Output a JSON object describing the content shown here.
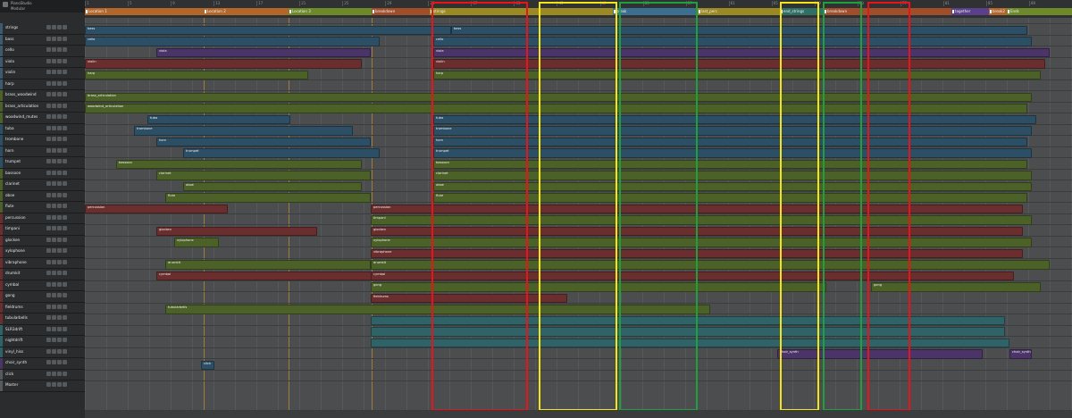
{
  "window": {
    "title": "PianoStudio",
    "project": "Modular"
  },
  "colors": {
    "blue": "#2c4f66",
    "green": "#4c6127",
    "red": "#6a2e2e",
    "purple": "#4b3468",
    "teal": "#2f6368",
    "highlight_red": "#e8141a",
    "highlight_yellow": "#f5e31a",
    "highlight_green": "#1fa03c"
  },
  "ruler": {
    "bars": [
      "1",
      "5",
      "9",
      "13",
      "17",
      "21",
      "25",
      "29",
      "33",
      "37",
      "41",
      "45",
      "49",
      "53",
      "57",
      "61",
      "65",
      "69",
      "73",
      "77",
      "81",
      "85",
      "89"
    ],
    "locators": [
      {
        "label": "Location 1",
        "color": "#b3662a"
      },
      {
        "label": "Location 2",
        "color": "#b3662a"
      },
      {
        "label": "Location 3",
        "color": "#6d8a2a"
      },
      {
        "label": "breakdown",
        "color": "#a04d2a"
      },
      {
        "label": "strings",
        "color": "#9b8a24"
      },
      {
        "label": "break",
        "color": "#3b6e8f"
      },
      {
        "label": "last_perc",
        "color": "#9b8a24"
      },
      {
        "label": "end_strings",
        "color": "#2f6f64"
      },
      {
        "label": "breakdown",
        "color": "#a04d2a"
      },
      {
        "label": "together",
        "color": "#5a3f8a"
      },
      {
        "label": "break2",
        "color": "#b3662a"
      },
      {
        "label": "Ends",
        "color": "#6d8a2a"
      }
    ]
  },
  "tracks": [
    {
      "name": "strings",
      "color": "#3d5a6e"
    },
    {
      "name": "bass",
      "color": "#3d5a6e"
    },
    {
      "name": "cello",
      "color": "#3d5a6e"
    },
    {
      "name": "viola",
      "color": "#3d5a6e"
    },
    {
      "name": "violin",
      "color": "#3d5a6e"
    },
    {
      "name": "harp",
      "color": "#3d5a6e"
    },
    {
      "name": "brass_woodwind",
      "color": "#4c6127"
    },
    {
      "name": "brass_articulation",
      "color": "#4c6127"
    },
    {
      "name": "woodwind_mutes",
      "color": "#4c6127"
    },
    {
      "name": "tuba",
      "color": "#2c4f66"
    },
    {
      "name": "trombone",
      "color": "#2c4f66"
    },
    {
      "name": "horn",
      "color": "#2c4f66"
    },
    {
      "name": "trumpet",
      "color": "#2c4f66"
    },
    {
      "name": "bassoon",
      "color": "#4c6127"
    },
    {
      "name": "clarinet",
      "color": "#4c6127"
    },
    {
      "name": "oboe",
      "color": "#4c6127"
    },
    {
      "name": "flute",
      "color": "#4c6127"
    },
    {
      "name": "percussion",
      "color": "#6a2e2e"
    },
    {
      "name": "timpani",
      "color": "#6a2e2e"
    },
    {
      "name": "glocken",
      "color": "#6a2e2e"
    },
    {
      "name": "xylophone",
      "color": "#6a2e2e"
    },
    {
      "name": "vibraphone",
      "color": "#6a2e2e"
    },
    {
      "name": "drumkit",
      "color": "#6a2e2e"
    },
    {
      "name": "cymbal",
      "color": "#6a2e2e"
    },
    {
      "name": "gong",
      "color": "#6a2e2e"
    },
    {
      "name": "fieldrums",
      "color": "#6a2e2e"
    },
    {
      "name": "tubularbells",
      "color": "#6a2e2e"
    },
    {
      "name": "SLR3drift",
      "color": "#2f6368"
    },
    {
      "name": "nightdrift",
      "color": "#2f6368"
    },
    {
      "name": "vinyl_hiss",
      "color": "#2f6368"
    },
    {
      "name": "choir_synth",
      "color": "#4b3468"
    },
    {
      "name": "click",
      "color": "#555a5e"
    },
    {
      "name": "Master",
      "color": "#555a5e"
    }
  ],
  "clips": [
    {
      "label": "bass",
      "track": 1
    },
    {
      "label": "cello",
      "track": 2
    },
    {
      "label": "viola",
      "track": 3
    },
    {
      "label": "violin",
      "track": 4
    },
    {
      "label": "harp",
      "track": 5
    },
    {
      "label": "brass_articulation",
      "track": 7
    },
    {
      "label": "woodwind_articulation",
      "track": 8
    },
    {
      "label": "tuba",
      "track": 9
    },
    {
      "label": "trombone",
      "track": 10
    },
    {
      "label": "horn",
      "track": 11
    },
    {
      "label": "trumpet",
      "track": 12
    },
    {
      "label": "bassoon",
      "track": 13
    },
    {
      "label": "clarinet",
      "track": 14
    },
    {
      "label": "oboe",
      "track": 15
    },
    {
      "label": "flute",
      "track": 16
    },
    {
      "label": "percussion",
      "track": 17
    },
    {
      "label": "timpani",
      "track": 18
    },
    {
      "label": "glocken",
      "track": 19
    },
    {
      "label": "xylophone",
      "track": 20
    },
    {
      "label": "vibraphone",
      "track": 21
    },
    {
      "label": "drumkit",
      "track": 22
    },
    {
      "label": "cymbal",
      "track": 23
    },
    {
      "label": "gong",
      "track": 24
    },
    {
      "label": "fieldrums",
      "track": 25
    },
    {
      "label": "tubularbells",
      "track": 26
    },
    {
      "label": "choir_synth",
      "track": 30
    },
    {
      "label": "click",
      "track": 31
    }
  ]
}
